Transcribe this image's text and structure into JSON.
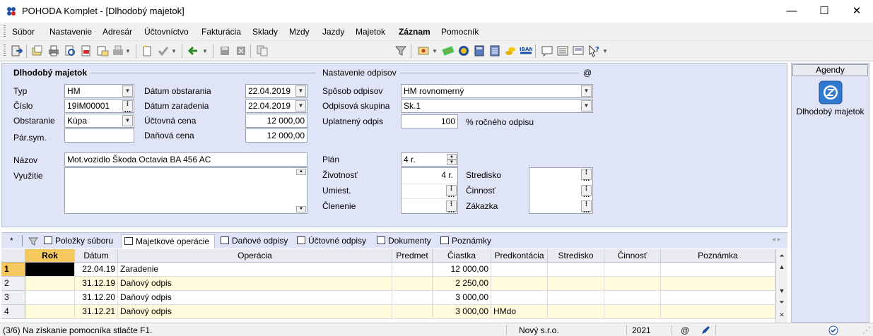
{
  "window": {
    "title": "POHODA Komplet - [Dlhodobý majetok]",
    "minimize": "—",
    "maximize": "☐",
    "close": "✕"
  },
  "menu": [
    "Súbor",
    "Nastavenie",
    "Adresár",
    "Účtovníctvo",
    "Fakturácia",
    "Sklady",
    "Mzdy",
    "Jazdy",
    "Majetok",
    "Záznam",
    "Pomocník"
  ],
  "toolbar": {
    "combo_value": ""
  },
  "form": {
    "group_main": "Dlhodobý majetok",
    "group_depr": "Nastavenie odpisov",
    "at_symbol": "@",
    "typ_label": "Typ",
    "typ_value": "HM",
    "cislo_label": "Číslo",
    "cislo_value": "19IM00001",
    "obstaranie_label": "Obstaranie",
    "obstaranie_value": "Kúpa",
    "parsym_label": "Pár.sym.",
    "parsym_value": "",
    "datum_obst_label": "Dátum obstarania",
    "datum_obst_value": "22.04.2019",
    "datum_zar_label": "Dátum zaradenia",
    "datum_zar_value": "22.04.2019",
    "uctovna_label": "Účtovná cena",
    "uctovna_value": "12 000,00",
    "danova_label": "Daňová cena",
    "danova_value": "12 000,00",
    "nazov_label": "Názov",
    "nazov_value": "Mot.vozidlo Škoda Octavia BA 456 AC",
    "vyuzitie_label": "Využitie",
    "vyuzitie_value": "",
    "sposob_label": "Spôsob odpisov",
    "sposob_value": "HM rovnomerný",
    "skupina_label": "Odpisová skupina",
    "skupina_value": "Sk.1",
    "uplatneny_label": "Uplatnený odpis",
    "uplatneny_value": "100",
    "uplatneny_suffix": "% ročného odpisu",
    "plan_label": "Plán",
    "plan_value": "4 r.",
    "zivotnost_label": "Životnosť",
    "zivotnost_value": "4 r.",
    "umiest_label": "Umiest.",
    "umiest_value": "",
    "clenenie_label": "Členenie",
    "clenenie_value": "",
    "stredisko_label": "Stredisko",
    "cinnost_label": "Činnosť",
    "zakazka_label": "Zákazka"
  },
  "tabs": {
    "star": "*",
    "items": [
      "Položky súboru",
      "Majetkové operácie",
      "Daňové odpisy",
      "Účtovné odpisy",
      "Dokumenty",
      "Poznámky"
    ],
    "active": "Majetkové operácie",
    "nav": "◂ ▸"
  },
  "grid": {
    "columns": [
      "Rok",
      "Dátum",
      "Operácia",
      "Predmet",
      "Čiastka",
      "Predkontácia",
      "Stredisko",
      "Činnosť",
      "Poznámka"
    ],
    "rows": [
      {
        "n": "1",
        "rok": "",
        "datum": "22.04.19",
        "operacia": "Zaradenie",
        "predmet": "",
        "ciastka": "12 000,00",
        "predkontacia": "",
        "stredisko": "",
        "cinnost": "",
        "poznamka": ""
      },
      {
        "n": "2",
        "rok": "",
        "datum": "31.12.19",
        "operacia": "Daňový odpis",
        "predmet": "",
        "ciastka": "2 250,00",
        "predkontacia": "",
        "stredisko": "",
        "cinnost": "",
        "poznamka": ""
      },
      {
        "n": "3",
        "rok": "",
        "datum": "31.12.20",
        "operacia": "Daňový odpis",
        "predmet": "",
        "ciastka": "3 000,00",
        "predkontacia": "",
        "stredisko": "",
        "cinnost": "",
        "poznamka": ""
      },
      {
        "n": "4",
        "rok": "",
        "datum": "31.12.21",
        "operacia": "Daňový odpis",
        "predmet": "",
        "ciastka": "3 000,00",
        "predkontacia": "HMdo",
        "stredisko": "",
        "cinnost": "",
        "poznamka": ""
      }
    ]
  },
  "agendy": {
    "title": "Agendy",
    "item": "Dlhodobý majetok"
  },
  "status": {
    "hint": "(3/6) Na získanie pomocníka stlačte F1.",
    "company": "Nový s.r.o.",
    "year": "2021",
    "at": "@"
  },
  "colors": {
    "form_bg": "#dfe5f6",
    "row_alt": "#fffbdc",
    "selection": "#f5c85d"
  }
}
